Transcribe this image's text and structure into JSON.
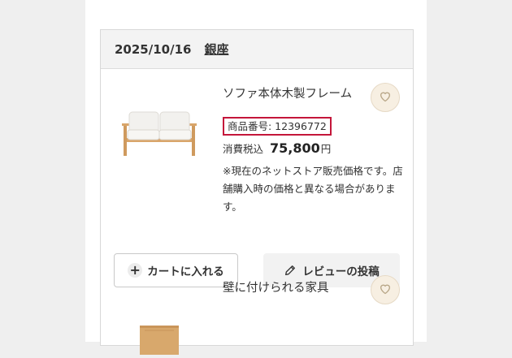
{
  "header": {
    "date": "2025/10/16",
    "store": "銀座"
  },
  "items": [
    {
      "name": "ソファ本体木製フレーム",
      "product_number": "商品番号: 12396772",
      "tax_label": "消費税込",
      "price": "75,800",
      "currency": "円",
      "note": "※現在のネットストア販売価格です。店舗購入時の価格と異なる場合があります。",
      "favorite_icon": "heart-icon"
    },
    {
      "name": "壁に付けられる家具",
      "favorite_icon": "heart-icon"
    }
  ],
  "buttons": {
    "add_to_cart": "カートに入れる",
    "write_review": "レビューの投稿"
  },
  "colors": {
    "highlight_border": "#c4163a",
    "favorite_bg": "#f7efe2"
  }
}
